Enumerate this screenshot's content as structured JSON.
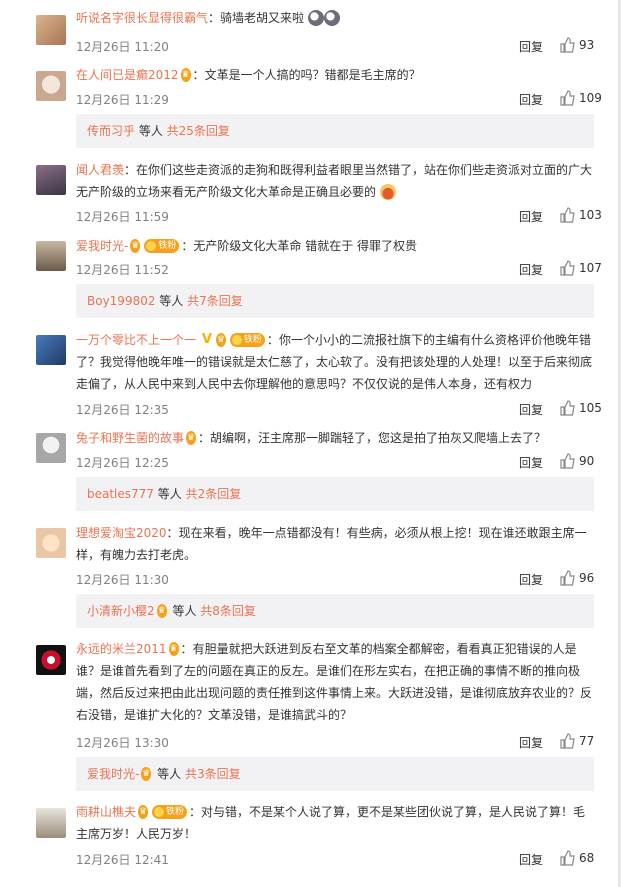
{
  "colors": {
    "username": "#eb7350",
    "text": "#333333",
    "time": "#808080",
    "sub_bg": "#f2f2f5"
  },
  "reply_label": "回复",
  "like_icon": "thumb-up-icon",
  "comments": [
    {
      "user": "听说名字很长显得很霸气",
      "sep": "：",
      "text": "骑墙老胡又来啦",
      "time": "12月26日 11:20",
      "likes": "93",
      "badges": [],
      "emoji": [
        "face-icon",
        "face-icon"
      ]
    },
    {
      "user": "在人间已是癫2012",
      "sep": "：",
      "text": "文革是一个人搞的吗？错都是毛主席的？",
      "time": "12月26日 11:29",
      "likes": "109",
      "badges": [
        "fan-icon"
      ]
    },
    {
      "user": "闻人君羡",
      "sep": "：",
      "text": "在你们这些走资派的走狗和既得利益者眼里当然错了，站在你们些走资派对立面的广大无产阶级的立场来看无产阶级文化大革命是正确且必要的",
      "time": "12月26日 11:59",
      "likes": "103",
      "badges": [],
      "emoji": [
        "cake-icon"
      ]
    },
    {
      "user": "爱我时光-",
      "sep": "：",
      "text": "无产阶级文化大革命 错就在于 得罪了权贵",
      "time": "12月26日 11:52",
      "likes": "107",
      "badges": [
        "fan-icon",
        "fan-badge"
      ]
    },
    {
      "user": "一万个零比不上一个一",
      "sep": "：",
      "text": "你一个小小的二流报社旗下的主编有什么资格评价他晚年错了？我觉得他晚年唯一的错误就是太仁慈了，太心软了。没有把该处理的人处理！以至于后来彻底走偏了，从人民中来到人民中去你理解他的意思吗？不仅仅说的是伟人本身，还有权力",
      "time": "12月26日 12:35",
      "likes": "105",
      "badges": [
        "v",
        "fan-icon",
        "fan-badge"
      ]
    },
    {
      "user": "兔子和野生菌的故事",
      "sep": "：",
      "text": "胡编啊，汪主席那一脚踹轻了，您这是拍了拍灰又爬墙上去了？",
      "time": "12月26日 12:25",
      "likes": "90",
      "badges": [
        "fan-icon"
      ]
    },
    {
      "user": "理想爱淘宝2020",
      "sep": "：",
      "text": "现在来看，晚年一点错都没有！有些病，必须从根上挖！现在谁还敢跟主席一样，有魄力去打老虎。",
      "time": "12月26日 11:30",
      "likes": "96",
      "badges": []
    },
    {
      "user": "永远的米兰2011",
      "sep": "：",
      "text": "有胆量就把大跃进到反右至文革的档案全都解密，看看真正犯错误的人是谁？是谁首先看到了左的问题在真正的反左。是谁们在形左实右，在把正确的事情不断的推向极端，然后反过来把由此出现问题的责任推到这件事情上来。大跃进没错，是谁彻底放弃农业的？反右没错，是谁扩大化的？文革没错，是谁搞武斗的？",
      "time": "12月26日 13:30",
      "likes": "77",
      "badges": [
        "fan-icon"
      ]
    },
    {
      "user": "雨耕山樵夫",
      "sep": "：",
      "text": "对与错，不是某个人说了算，更不是某些团伙说了算，是人民说了算！毛主席万岁！人民万岁！",
      "time": "12月26日 12:41",
      "likes": "68",
      "badges": [
        "fan-icon",
        "fan-badge"
      ]
    }
  ],
  "sub_replies": [
    {
      "user": "传而习乎",
      "mid": " 等人 ",
      "total": "共25条回复"
    },
    {
      "user": "Boy199802",
      "mid": " 等人 ",
      "total": "共7条回复"
    },
    {
      "user": "beatles777",
      "mid": " 等人 ",
      "total": "共2条回复"
    },
    {
      "user": "小清新小樱2",
      "mid": " 等人 ",
      "total": "共8条回复"
    },
    {
      "user": "爱我时光-",
      "mid": " 等人 ",
      "total": "共3条回复"
    }
  ],
  "badge_labels": {
    "fan": "铁粉",
    "vip": "♛"
  }
}
